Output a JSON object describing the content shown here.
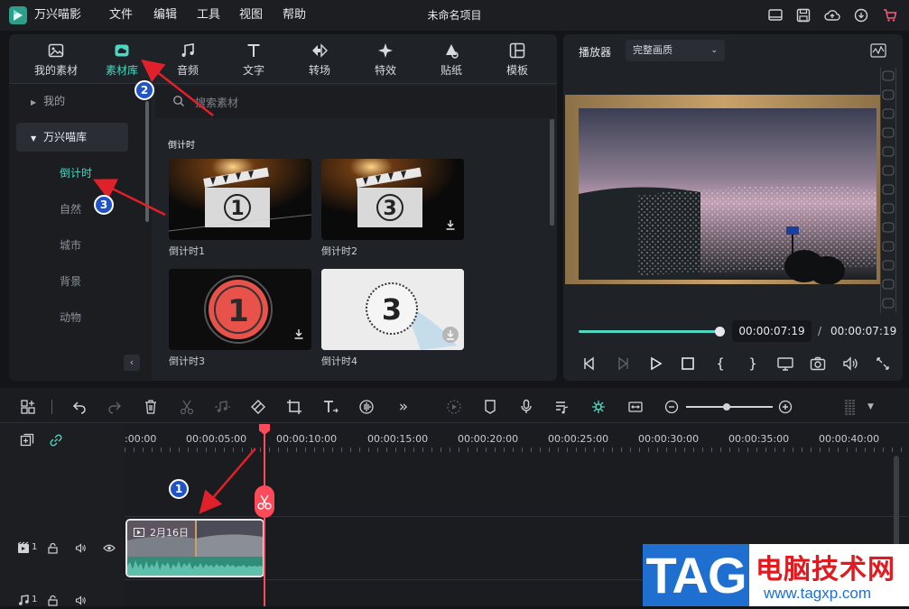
{
  "app": {
    "title": "万兴喵影",
    "project_title": "未命名项目"
  },
  "menu": [
    "文件",
    "编辑",
    "工具",
    "视图",
    "帮助"
  ],
  "media_tabs": [
    {
      "label": "我的素材",
      "icon": "image-icon"
    },
    {
      "label": "素材库",
      "icon": "cloud-library-icon"
    },
    {
      "label": "音频",
      "icon": "music-note-icon"
    },
    {
      "label": "文字",
      "icon": "text-icon"
    },
    {
      "label": "转场",
      "icon": "transition-icon"
    },
    {
      "label": "特效",
      "icon": "sparkle-icon"
    },
    {
      "label": "贴纸",
      "icon": "sticker-icon"
    },
    {
      "label": "模板",
      "icon": "template-icon"
    }
  ],
  "sidebar": {
    "mine": "我的",
    "library": "万兴喵库",
    "items": [
      "倒计时",
      "自然",
      "城市",
      "背景",
      "动物"
    ]
  },
  "search": {
    "placeholder": "搜索素材"
  },
  "section_title": "倒计时",
  "assets": [
    {
      "label": "倒计时1",
      "digit": "1"
    },
    {
      "label": "倒计时2",
      "digit": "3"
    },
    {
      "label": "倒计时3",
      "digit": "1"
    },
    {
      "label": "倒计时4",
      "digit": "3"
    }
  ],
  "player": {
    "label": "播放器",
    "quality": "完整画质",
    "current_time": "00:00:07:19",
    "separator": "/",
    "total_time": "00:00:07:19",
    "progress": 1.0
  },
  "timeline": {
    "ruler": [
      ":00:00",
      "00:00:05:00",
      "00:00:10:00",
      "00:00:15:00",
      "00:00:20:00",
      "00:00:25:00",
      "00:00:30:00",
      "00:00:35:00",
      "00:00:40:00"
    ],
    "clip_label": "2月16日",
    "video_track_number": "1",
    "audio_track_number": "1"
  },
  "annotations": [
    "1",
    "2",
    "3"
  ],
  "watermark": {
    "tag": "TAG",
    "title": "电脑技术网",
    "url": "www.tagxp.com"
  },
  "colors": {
    "accent": "#4fd6c0",
    "playhead": "#ff4a5a",
    "arrow": "#e0202a",
    "badge": "#2152c6"
  }
}
